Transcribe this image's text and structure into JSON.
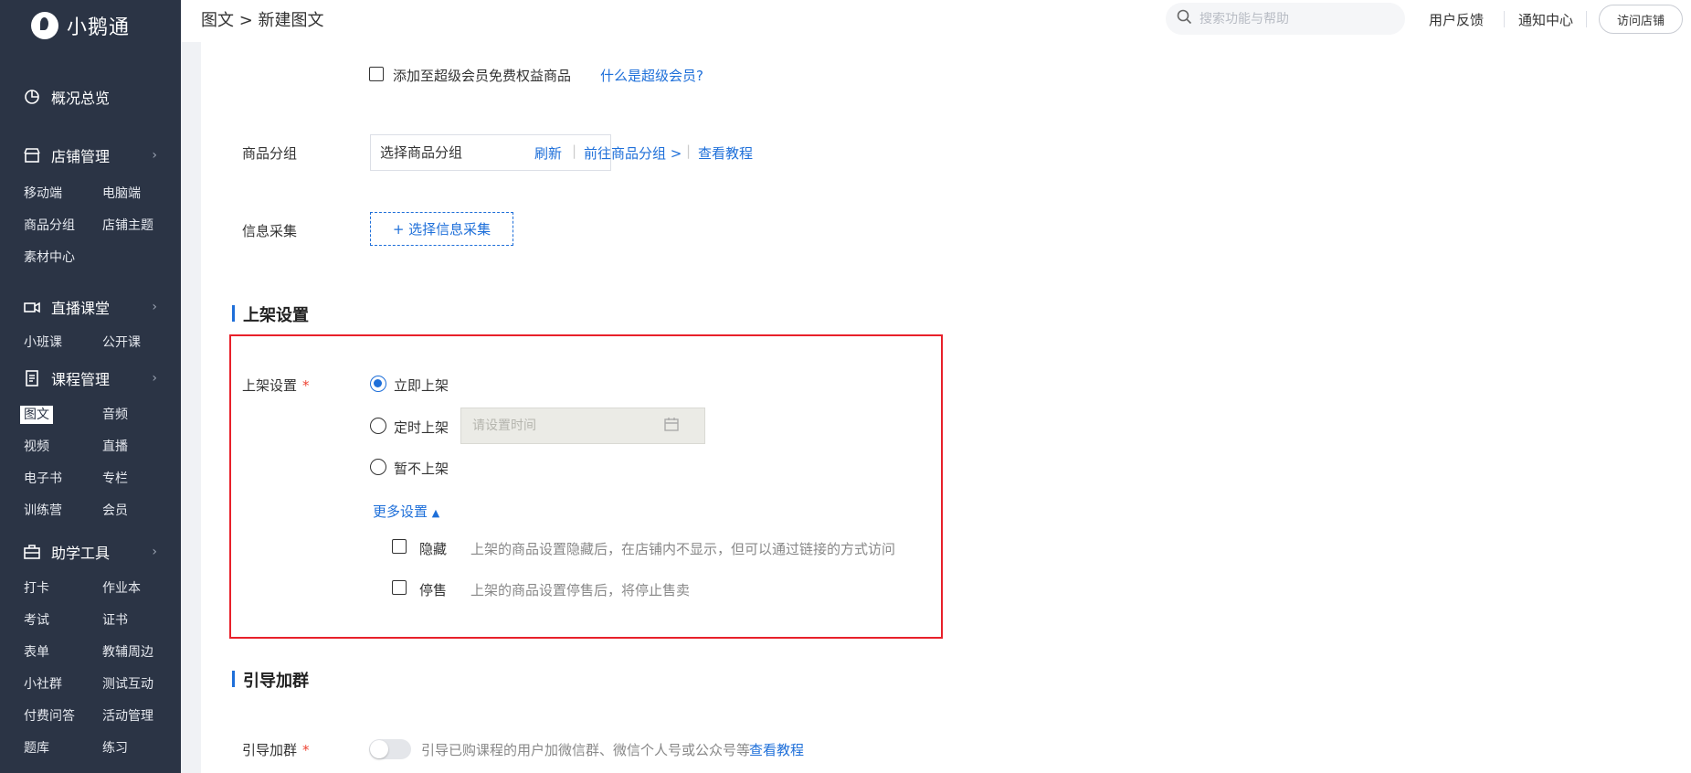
{
  "app": {
    "name": "小鹅通"
  },
  "breadcrumb": "图文 > 新建图文",
  "header": {
    "search_placeholder": "搜索功能与帮助",
    "feedback": "用户反馈",
    "notifications": "通知中心",
    "visit_store": "访问店铺"
  },
  "sidebar": {
    "overview": "概况总览",
    "store": {
      "title": "店铺管理",
      "items": [
        "移动端",
        "电脑端",
        "商品分组",
        "店铺主题",
        "素材中心"
      ]
    },
    "live": {
      "title": "直播课堂",
      "items": [
        "小班课",
        "公开课"
      ]
    },
    "course": {
      "title": "课程管理",
      "items": [
        "图文",
        "音频",
        "视频",
        "直播",
        "电子书",
        "专栏",
        "训练营",
        "会员"
      ]
    },
    "tools": {
      "title": "助学工具",
      "items": [
        "打卡",
        "作业本",
        "考试",
        "证书",
        "表单",
        "教辅周边",
        "小社群",
        "测试互动",
        "付费问答",
        "活动管理",
        "题库",
        "练习"
      ]
    }
  },
  "form": {
    "super_member_checkbox": "添加至超级会员免费权益商品",
    "super_member_link": "什么是超级会员?",
    "group_label": "商品分组",
    "group_select_value": "选择商品分组",
    "refresh": "刷新",
    "go_group": "前往商品分组 >",
    "tutorial": "查看教程",
    "info_label": "信息采集",
    "info_button": "+ 选择信息采集"
  },
  "listing": {
    "section_title": "上架设置",
    "label": "上架设置",
    "required_mark": "*",
    "options": [
      "立即上架",
      "定时上架",
      "暂不上架"
    ],
    "selected": "立即上架",
    "time_placeholder": "请设置时间",
    "more_settings": "更多设置",
    "hide_label": "隐藏",
    "hide_desc": "上架的商品设置隐藏后，在店铺内不显示，但可以通过链接的方式访问",
    "stop_label": "停售",
    "stop_desc": "上架的商品设置停售后，将停止售卖"
  },
  "guide": {
    "section_title": "引导加群",
    "label": "引导加群",
    "required_mark": "*",
    "desc": "引导已购课程的用户加微信群、微信个人号或公众号等",
    "tutorial": "查看教程",
    "enabled": false
  },
  "colors": {
    "sidebar_bg": "#2b3445",
    "accent": "#1e6fd9",
    "highlight_border": "#e8202a"
  }
}
